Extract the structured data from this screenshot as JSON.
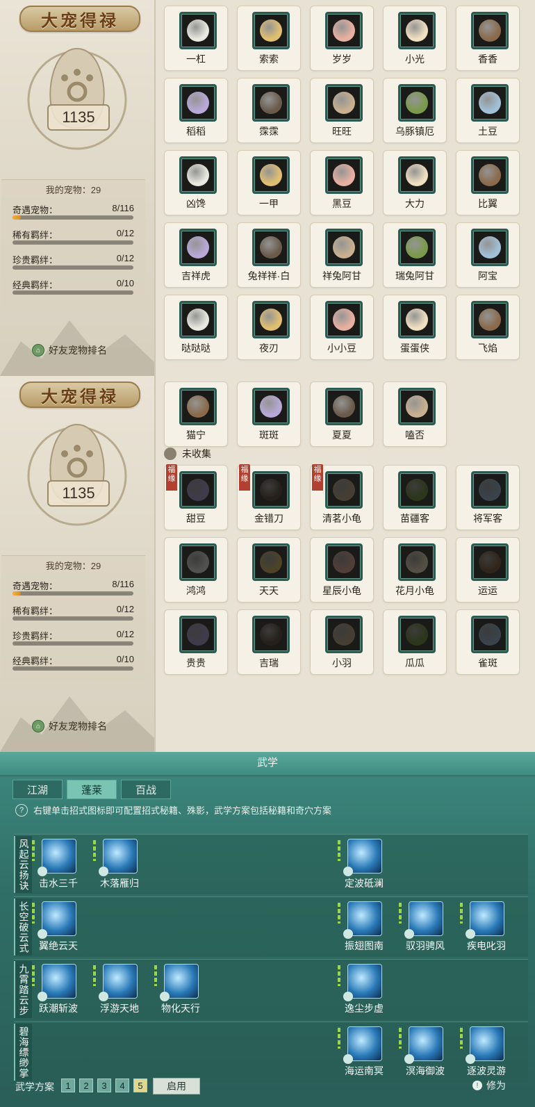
{
  "panel1": {
    "title": "大宠得禄",
    "score": "1135",
    "my_pets_label": "我的宠物：29",
    "stats": [
      {
        "label": "奇遇宠物：",
        "value": "8/116",
        "progress": 0.07
      },
      {
        "label": "稀有羁绊：",
        "value": "0/12",
        "progress": 0
      },
      {
        "label": "珍贵羁绊：",
        "value": "0/12",
        "progress": 0
      },
      {
        "label": "经典羁绊：",
        "value": "0/10",
        "progress": 0
      }
    ],
    "friend_rank": "好友宠物排名",
    "pets": [
      "一杠",
      "索索",
      "岁岁",
      "小光",
      "香香",
      "稻稻",
      "霂霂",
      "旺旺",
      "乌豚镇厄",
      "土豆",
      "凶馋",
      "一甲",
      "黑豆",
      "大力",
      "比翼",
      "吉祥虎",
      "兔祥祥·白",
      "祥兔阿甘",
      "瑞兔阿甘",
      "阿宝",
      "哒哒哒",
      "夜刃",
      "小小豆",
      "蛋蛋侠",
      "飞焰"
    ]
  },
  "panel2": {
    "title": "大宠得禄",
    "score": "1135",
    "my_pets_label": "我的宠物：29",
    "stats": [
      {
        "label": "奇遇宠物：",
        "value": "8/116",
        "progress": 0.07
      },
      {
        "label": "稀有羁绊：",
        "value": "0/12",
        "progress": 0
      },
      {
        "label": "珍贵羁绊：",
        "value": "0/12",
        "progress": 0
      },
      {
        "label": "经典羁绊：",
        "value": "0/10",
        "progress": 0
      }
    ],
    "friend_rank": "好友宠物排名",
    "collected": [
      "猫宁",
      "斑斑",
      "夏夏",
      "嗑否"
    ],
    "uncollected_label": "未收集",
    "fate_tag": "福缘",
    "uncollected": [
      "甜豆",
      "金错刀",
      "清茗小龟",
      "苗疆客",
      "将军客",
      "鸿鸿",
      "天天",
      "星辰小龟",
      "花月小龟",
      "运运",
      "贵贵",
      "吉瑞",
      "小羽",
      "瓜瓜",
      "雀斑"
    ]
  },
  "wuxue": {
    "title": "武学",
    "tabs": [
      "江湖",
      "蓬莱",
      "百战"
    ],
    "active_tab": "蓬莱",
    "hint": "右键单击招式图标即可配置招式秘籍、殊影，武学方案包括秘籍和奇穴方案",
    "rows": [
      {
        "label": "风起云扬诀",
        "skills": [
          "击水三千",
          "木落雁归",
          "定波砥澜"
        ]
      },
      {
        "label": "长空破云式",
        "skills": [
          "翼绝云天",
          "振翅图南",
          "驭羽骋风",
          "疾电叱羽"
        ]
      },
      {
        "label": "九霄踏云步",
        "skills": [
          "跃潮斩波",
          "浮游天地",
          "物化天行",
          "逸尘步虚"
        ]
      },
      {
        "label": "碧海缥缈掌",
        "skills": [
          "海运南冥",
          "溟海御波",
          "逐波灵游"
        ]
      }
    ],
    "plan_label": "武学方案",
    "plan_numbers": [
      "1",
      "2",
      "3",
      "4",
      "5"
    ],
    "active_plan": "5",
    "enable_label": "启用",
    "xiuwei_label": "修为"
  },
  "colors": {
    "accent": "#3e8a80",
    "progress": "#e0a030",
    "fate_tag": "#b24030"
  }
}
